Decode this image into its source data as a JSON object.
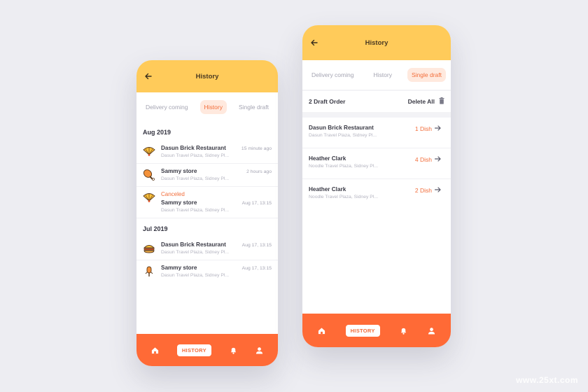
{
  "left_screen": {
    "header": {
      "title": "History"
    },
    "tabs": [
      {
        "label": "Delivery coming",
        "active": false
      },
      {
        "label": "History",
        "active": true
      },
      {
        "label": "Single draft",
        "active": false
      }
    ],
    "sections": [
      {
        "title": "Aug 2019",
        "items": [
          {
            "icon": "hand-fan-icon",
            "name": "Dasun Brick Restaurant",
            "status": "",
            "address": "Dasun Travel Plaza, Sidney Pl...",
            "time": "15 minute ago"
          },
          {
            "icon": "chicken-leg-icon",
            "name": "Sammy store",
            "status": "",
            "address": "Dasun Travel Plaza, Sidney Pl...",
            "time": "2 hours ago"
          },
          {
            "icon": "hand-fan-icon",
            "name": "Sammy store",
            "status": "Canceled",
            "address": "Dasun Travel Plaza, Sidney Pl...",
            "time": "Aug 17, 13:15"
          }
        ]
      },
      {
        "title": "Jul 2019",
        "items": [
          {
            "icon": "burger-icon",
            "name": "Dasun Brick Restaurant",
            "status": "",
            "address": "Dasun Travel Plaza, Sidney Pl...",
            "time": "Aug 17, 13:15"
          },
          {
            "icon": "ice-cream-icon",
            "name": "Sammy store",
            "status": "",
            "address": "Dasun Travel Plaza, Sidney Pl...",
            "time": "Aug 17, 13:15"
          }
        ]
      }
    ],
    "nav": {
      "active_label": "HISTORY"
    }
  },
  "right_screen": {
    "header": {
      "title": "History"
    },
    "tabs": [
      {
        "label": "Delivery coming",
        "active": false
      },
      {
        "label": "History",
        "active": false
      },
      {
        "label": "Single draft",
        "active": true
      }
    ],
    "draft_count": "2 Draft Order",
    "delete_all": "Delete All",
    "drafts": [
      {
        "name": "Dasun Brick Restaurant",
        "address": "Dasun Travel Plaza, Sidney Pl...",
        "dishes": "1 Dish"
      },
      {
        "name": "Heather Clark",
        "address": "Noodle Travel Plaza, Sidney Pl...",
        "dishes": "4 Dish"
      },
      {
        "name": "Heather Clark",
        "address": "Noodle Travel Plaza, Sidney Pl...",
        "dishes": "2 Dish"
      }
    ],
    "nav": {
      "active_label": "HISTORY"
    }
  },
  "watermark": "www.25xt.com",
  "colors": {
    "header_yellow": "#ffcb5a",
    "accent_orange": "#ff6a36",
    "active_tab_bg": "#ffe9de",
    "text_dark": "#3a3a45",
    "text_muted": "#b4b4c0"
  }
}
